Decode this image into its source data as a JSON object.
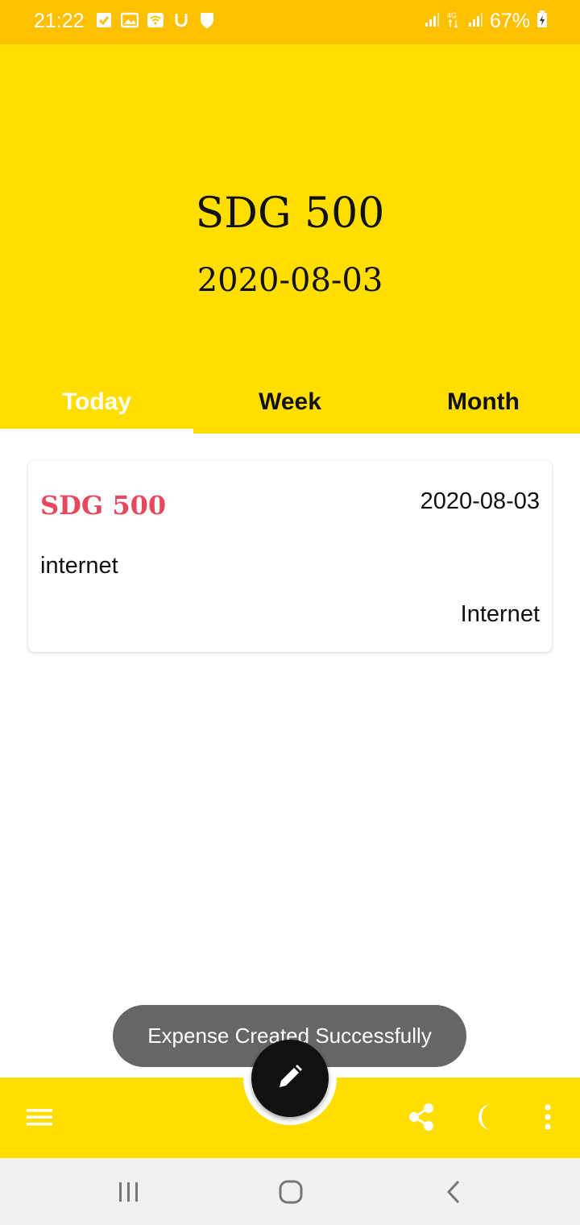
{
  "status_bar": {
    "time": "21:22",
    "battery": "67%",
    "icons": [
      "check-box-icon",
      "image-icon",
      "wifi-icon",
      "u-icon",
      "shield-icon",
      "signal-icon",
      "4g-icon",
      "signal-icon",
      "battery-icon"
    ]
  },
  "header": {
    "amount": "SDG 500",
    "date": "2020-08-03"
  },
  "tabs": [
    {
      "label": "Today",
      "active": true
    },
    {
      "label": "Week",
      "active": false
    },
    {
      "label": "Month",
      "active": false
    }
  ],
  "expense": {
    "amount": "SDG 500",
    "date": "2020-08-03",
    "note": "internet",
    "category": "Internet"
  },
  "toast": {
    "message": "Expense Created Successfully"
  },
  "bottom_bar": {
    "icons": [
      "menu-icon",
      "share-icon",
      "moon-icon",
      "more-vert-icon"
    ],
    "fab_icon": "pencil-icon"
  },
  "nav_bar": {
    "icons": [
      "recents-icon",
      "home-icon",
      "back-icon"
    ]
  },
  "colors": {
    "status_bar": "#FFC000",
    "header": "#FFDE00",
    "accent_amount": "#E8485E",
    "fab": "#111111",
    "toast": "#666666"
  }
}
